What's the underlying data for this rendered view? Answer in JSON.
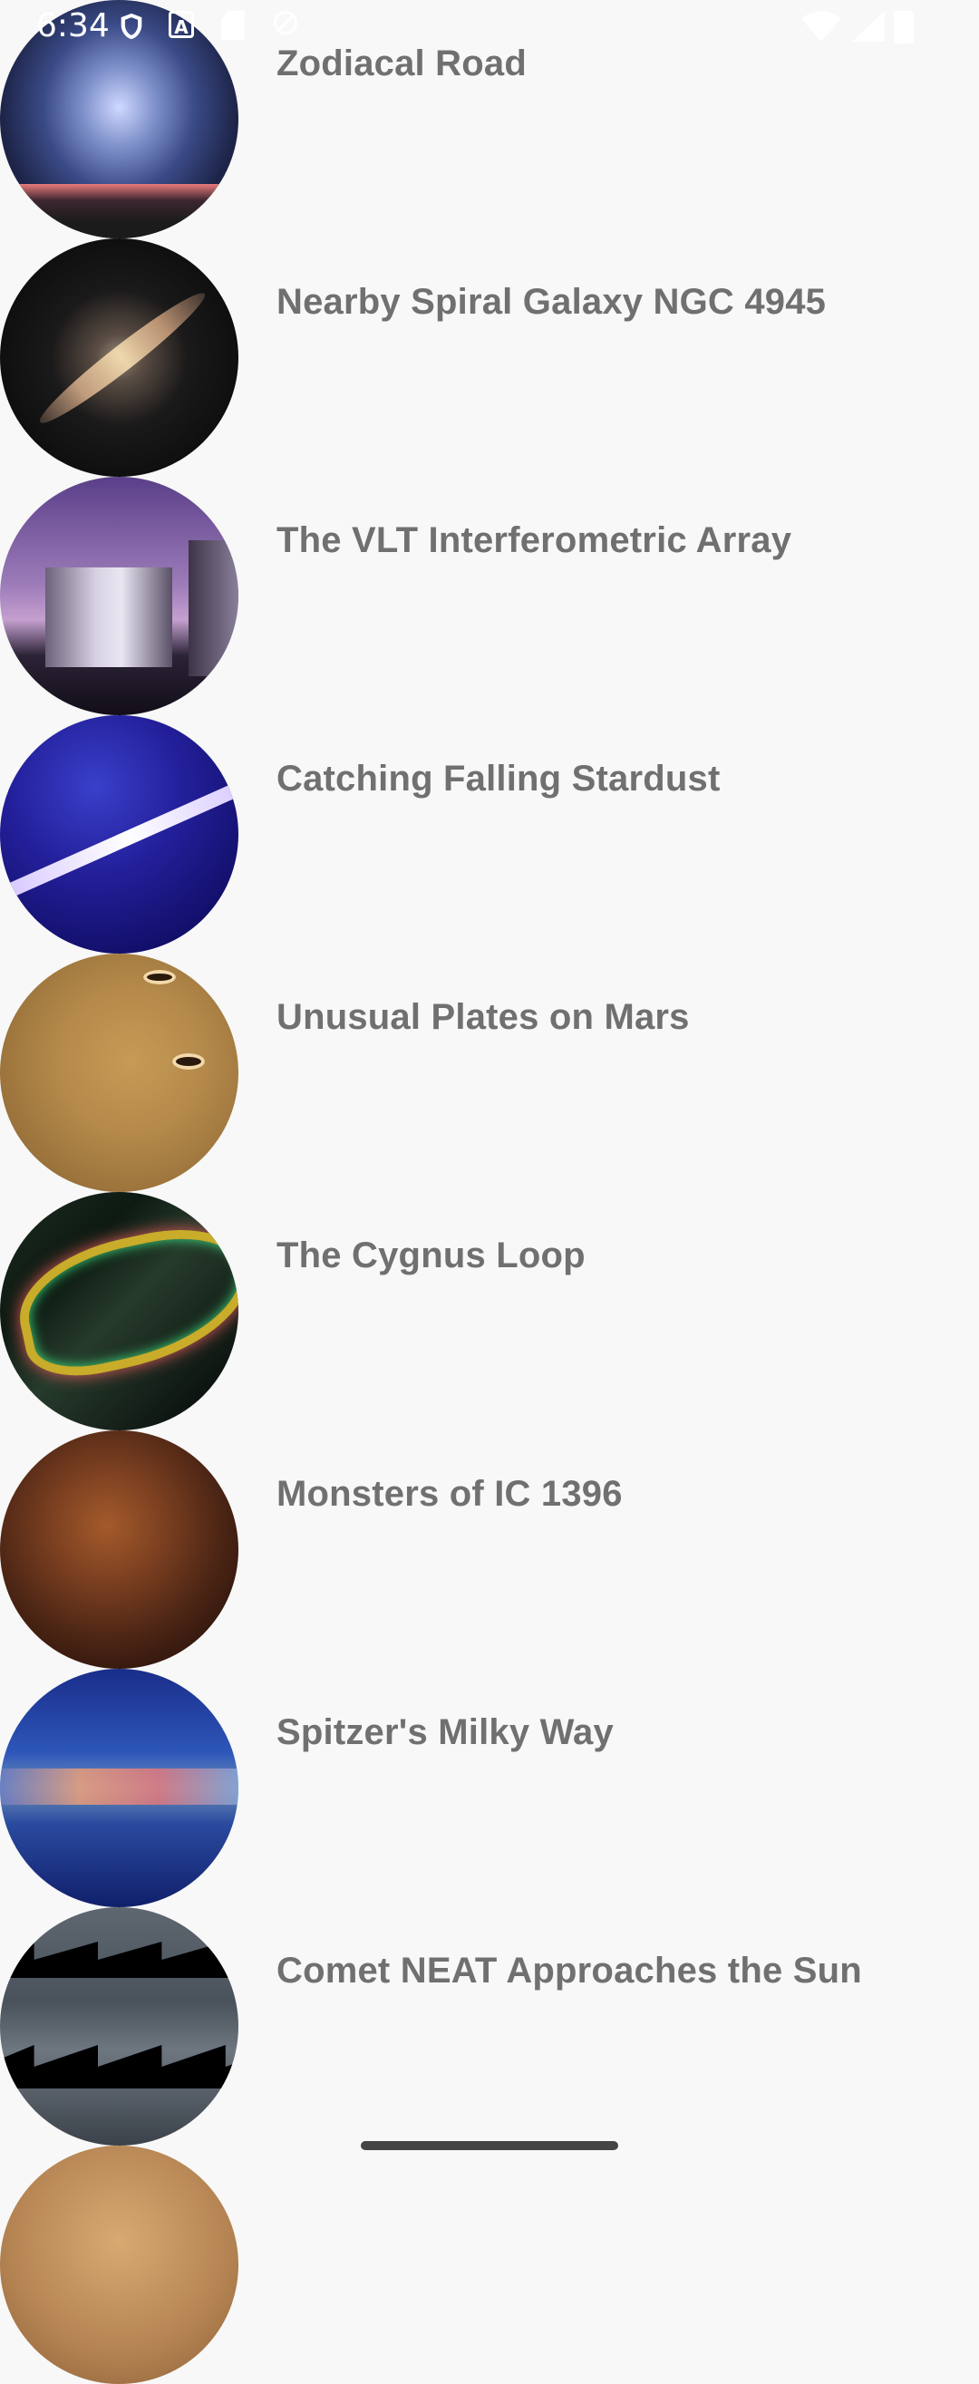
{
  "status_bar": {
    "time": "6:34",
    "icons": [
      "shield-icon",
      "a-icon",
      "sd-card-icon",
      "dnd-icon",
      "wifi-icon",
      "cell-signal-icon",
      "battery-icon"
    ]
  },
  "items": [
    {
      "title": "Zodiacal Road"
    },
    {
      "title": "Nearby Spiral Galaxy NGC 4945"
    },
    {
      "title": "The VLT Interferometric Array"
    },
    {
      "title": "Catching Falling Stardust"
    },
    {
      "title": "Unusual Plates on Mars"
    },
    {
      "title": "The Cygnus Loop"
    },
    {
      "title": "Monsters of IC 1396"
    },
    {
      "title": "Spitzer's Milky Way"
    },
    {
      "title": "Comet NEAT Approaches the Sun"
    },
    {
      "title": ""
    }
  ]
}
